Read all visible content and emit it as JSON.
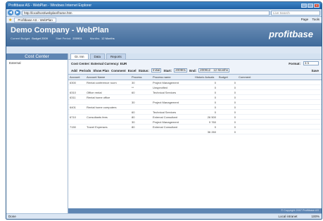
{
  "window": {
    "title": "Profitbase AS - WebPlan - Windows Internet Explorer"
  },
  "address": {
    "url": "http://localhost/webplan/frame.htm",
    "search_placeholder": "Live Search"
  },
  "browser_tab": {
    "label": "Profitbase AS - WebPlan",
    "tools": [
      "Page",
      "Tools"
    ]
  },
  "banner": {
    "company": "Demo Company - WebPlan",
    "current_budget_label": "Current Budget:",
    "current_budget": "Budget 2009",
    "start_period_label": "Start Period:",
    "start_period": "200901",
    "months_label": "Months:",
    "months": "12 Months",
    "logo": "profitbase"
  },
  "sidebar": {
    "header": "Cost Center",
    "items": [
      "External"
    ]
  },
  "subtabs": [
    "Gr. Inn",
    "Data",
    "Reports"
  ],
  "ccline": {
    "label": "Cost Center: External  Currency: EUR",
    "format_label": "Format:",
    "format_value": "1:1"
  },
  "toolbar": {
    "add": "Add",
    "periods": "Periods",
    "show_plan": "Show Plan",
    "comment": "Comment",
    "excel": "Excel",
    "status_label": "Status:",
    "status_value": "Initial",
    "start_label": "Start:",
    "start_value": "200901",
    "end_label": "End:",
    "end_value": "200912 - 12 Months",
    "save": "Save"
  },
  "table": {
    "headers": [
      "Account",
      "Account Name",
      "Process",
      "Process name",
      "Historic Actuals",
      "Budget",
      "Comment"
    ],
    "rows": [
      [
        "6300",
        "Rental conference room",
        "30",
        "Project Management",
        "0",
        "0",
        ""
      ],
      [
        "",
        "",
        "**",
        "Unspecified",
        "0",
        "0",
        ""
      ],
      [
        "6310",
        "Office rental",
        "60",
        "Technical Services",
        "0",
        "0",
        ""
      ],
      [
        "6311",
        "Rental home office",
        "",
        "",
        "0",
        "0",
        ""
      ],
      [
        "",
        "",
        "30",
        "Project Management",
        "0",
        "0",
        ""
      ],
      [
        "6401",
        "Rental home computers",
        "",
        "",
        "0",
        "0",
        ""
      ],
      [
        "",
        "",
        "60",
        "Technical Services",
        "0",
        "0",
        ""
      ],
      [
        "6710",
        "Consultants fees",
        "80",
        "External Consultant",
        "26 500",
        "0",
        ""
      ],
      [
        "",
        "",
        "30",
        "Project Management",
        "9 760",
        "0",
        ""
      ],
      [
        "7150",
        "Travel Expenses",
        "80",
        "External Consultant",
        "0",
        "0",
        ""
      ],
      [
        "",
        "",
        "",
        "",
        "36 260",
        "0",
        ""
      ]
    ]
  },
  "footer": {
    "copyright": "© Copyright 2007 Profitbase AS"
  },
  "status": {
    "left": "Done",
    "zone": "Local intranet",
    "zoom": "100%"
  }
}
